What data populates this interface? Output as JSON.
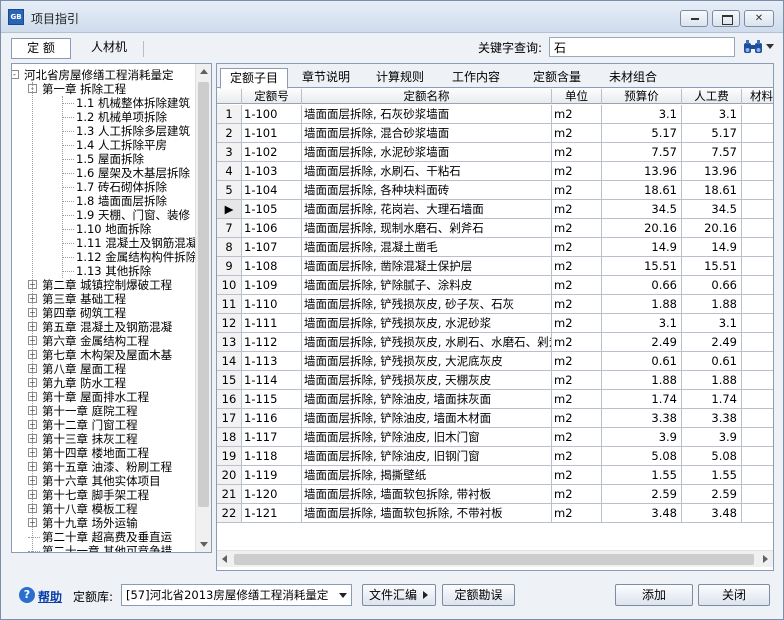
{
  "window": {
    "title": "项目指引",
    "app_icon_text": "GB"
  },
  "top_tabs": [
    "定 额",
    "人材机"
  ],
  "keyword": {
    "label": "关键字查询:",
    "value": "石"
  },
  "tree": [
    {
      "label": "河北省房屋修缮工程消耗量定",
      "level": 0,
      "expander": "-"
    },
    {
      "label": "第一章  拆除工程",
      "level": 1,
      "expander": "-"
    },
    {
      "label": "1.1 机械整体拆除建筑",
      "level": 2
    },
    {
      "label": "1.2 机械单项拆除",
      "level": 2
    },
    {
      "label": "1.3 人工拆除多层建筑",
      "level": 2
    },
    {
      "label": "1.4 人工拆除平房",
      "level": 2
    },
    {
      "label": "1.5 屋面拆除",
      "level": 2
    },
    {
      "label": "1.6 屋架及木基层拆除",
      "level": 2
    },
    {
      "label": "1.7 砖石砌体拆除",
      "level": 2
    },
    {
      "label": "1.8 墙面面层拆除",
      "level": 2,
      "selected": true
    },
    {
      "label": "1.9 天棚、门窗、装修",
      "level": 2
    },
    {
      "label": "1.10 地面拆除",
      "level": 2
    },
    {
      "label": "1.11 混凝土及钢筋混凝",
      "level": 2
    },
    {
      "label": "1.12 金属结构构件拆除",
      "level": 2
    },
    {
      "label": "1.13 其他拆除",
      "level": 2
    },
    {
      "label": "第二章  城镇控制爆破工程",
      "level": 1,
      "expander": "+"
    },
    {
      "label": "第三章  基础工程",
      "level": 1,
      "expander": "+"
    },
    {
      "label": "第四章  砌筑工程",
      "level": 1,
      "expander": "+"
    },
    {
      "label": "第五章  混凝土及钢筋混凝",
      "level": 1,
      "expander": "+"
    },
    {
      "label": "第六章  金属结构工程",
      "level": 1,
      "expander": "+"
    },
    {
      "label": "第七章  木构架及屋面木基",
      "level": 1,
      "expander": "+"
    },
    {
      "label": "第八章  屋面工程",
      "level": 1,
      "expander": "+"
    },
    {
      "label": "第九章  防水工程",
      "level": 1,
      "expander": "+"
    },
    {
      "label": "第十章  屋面排水工程",
      "level": 1,
      "expander": "+"
    },
    {
      "label": "第十一章  庭院工程",
      "level": 1,
      "expander": "+"
    },
    {
      "label": "第十二章  门窗工程",
      "level": 1,
      "expander": "+"
    },
    {
      "label": "第十三章  抹灰工程",
      "level": 1,
      "expander": "+"
    },
    {
      "label": "第十四章  楼地面工程",
      "level": 1,
      "expander": "+"
    },
    {
      "label": "第十五章  油漆、粉刷工程",
      "level": 1,
      "expander": "+"
    },
    {
      "label": "第十六章  其他实体项目",
      "level": 1,
      "expander": "+"
    },
    {
      "label": "第十七章  脚手架工程",
      "level": 1,
      "expander": "+"
    },
    {
      "label": "第十八章  模板工程",
      "level": 1,
      "expander": "+"
    },
    {
      "label": "第十九章  场外运输",
      "level": 1,
      "expander": "+"
    },
    {
      "label": "第二十章  超高费及垂直运",
      "level": 1
    },
    {
      "label": "第二十一章  其他可竞争措",
      "level": 1
    }
  ],
  "sub_tabs": [
    "定额子目",
    "章节说明",
    "计算规则",
    "工作内容",
    "定额含量",
    "未材组合"
  ],
  "grid": {
    "columns": [
      "",
      "定额号",
      "定额名称",
      "单位",
      "预算价",
      "人工费",
      "材料"
    ],
    "rows": [
      [
        "1",
        "1-100",
        "墙面面层拆除, 石灰砂浆墙面",
        "m2",
        "3.1",
        "3.1"
      ],
      [
        "2",
        "1-101",
        "墙面面层拆除, 混合砂浆墙面",
        "m2",
        "5.17",
        "5.17"
      ],
      [
        "3",
        "1-102",
        "墙面面层拆除, 水泥砂浆墙面",
        "m2",
        "7.57",
        "7.57"
      ],
      [
        "4",
        "1-103",
        "墙面面层拆除, 水刷石、干粘石",
        "m2",
        "13.96",
        "13.96"
      ],
      [
        "5",
        "1-104",
        "墙面面层拆除, 各种块料面砖",
        "m2",
        "18.61",
        "18.61"
      ],
      [
        "▶",
        "1-105",
        "墙面面层拆除, 花岗岩、大理石墙面",
        "m2",
        "34.5",
        "34.5"
      ],
      [
        "7",
        "1-106",
        "墙面面层拆除, 现制水磨石、剁斧石",
        "m2",
        "20.16",
        "20.16"
      ],
      [
        "8",
        "1-107",
        "墙面面层拆除, 混凝土凿毛",
        "m2",
        "14.9",
        "14.9"
      ],
      [
        "9",
        "1-108",
        "墙面面层拆除, 凿除混凝土保护层",
        "m2",
        "15.51",
        "15.51"
      ],
      [
        "10",
        "1-109",
        "墙面面层拆除, 铲除腻子、涂料皮",
        "m2",
        "0.66",
        "0.66"
      ],
      [
        "11",
        "1-110",
        "墙面面层拆除, 铲残损灰皮, 砂子灰、石灰",
        "m2",
        "1.88",
        "1.88"
      ],
      [
        "12",
        "1-111",
        "墙面面层拆除, 铲残损灰皮, 水泥砂浆",
        "m2",
        "3.1",
        "3.1"
      ],
      [
        "13",
        "1-112",
        "墙面面层拆除, 铲残损灰皮, 水刷石、水磨石、剁斧石",
        "m2",
        "2.49",
        "2.49"
      ],
      [
        "14",
        "1-113",
        "墙面面层拆除, 铲残损灰皮, 大泥底灰皮",
        "m2",
        "0.61",
        "0.61"
      ],
      [
        "15",
        "1-114",
        "墙面面层拆除, 铲残损灰皮, 天棚灰皮",
        "m2",
        "1.88",
        "1.88"
      ],
      [
        "16",
        "1-115",
        "墙面面层拆除, 铲除油皮, 墙面抹灰面",
        "m2",
        "1.74",
        "1.74"
      ],
      [
        "17",
        "1-116",
        "墙面面层拆除, 铲除油皮, 墙面木材面",
        "m2",
        "3.38",
        "3.38"
      ],
      [
        "18",
        "1-117",
        "墙面面层拆除, 铲除油皮, 旧木门窗",
        "m2",
        "3.9",
        "3.9"
      ],
      [
        "19",
        "1-118",
        "墙面面层拆除, 铲除油皮, 旧钢门窗",
        "m2",
        "5.08",
        "5.08"
      ],
      [
        "20",
        "1-119",
        "墙面面层拆除, 揭撕壁纸",
        "m2",
        "1.55",
        "1.55"
      ],
      [
        "21",
        "1-120",
        "墙面面层拆除, 墙面软包拆除, 带衬板",
        "m2",
        "2.59",
        "2.59"
      ],
      [
        "22",
        "1-121",
        "墙面面层拆除, 墙面软包拆除, 不带衬板",
        "m2",
        "3.48",
        "3.48"
      ]
    ]
  },
  "bottom": {
    "help_label": "帮助",
    "library_label": "定额库:",
    "library_value": "[57]河北省2013房屋修缮工程消耗量定",
    "summary_button": "文件汇编",
    "errata_button": "定额勘误",
    "add_button": "添加",
    "close_button": "关闭"
  },
  "colors": {
    "accent": "#2a64b5",
    "panel_border": "#8a9cb5",
    "background": "#eef1f6"
  }
}
